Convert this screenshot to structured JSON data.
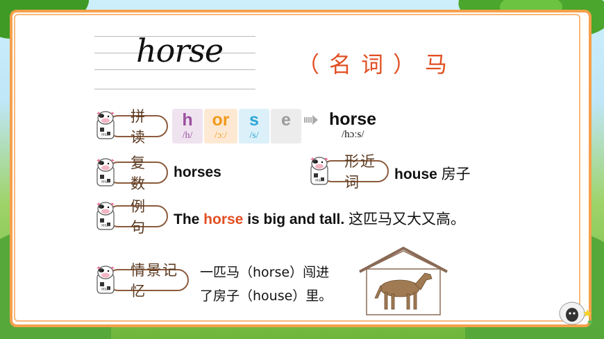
{
  "word": {
    "title": "horse",
    "meaning": "（名词）马"
  },
  "phonics": {
    "label": "拼读",
    "segments": [
      {
        "letters": "h",
        "ipa": "/h/",
        "color": "#9b4f9f",
        "bg": "#efe3f0"
      },
      {
        "letters": "or",
        "ipa": "/ɔː/",
        "color": "#f19a1c",
        "bg": "#fde9d3"
      },
      {
        "letters": "s",
        "ipa": "/s/",
        "color": "#2ba6d8",
        "bg": "#dcf0fa"
      },
      {
        "letters": "e",
        "ipa": "",
        "color": "#9a9a9a",
        "bg": "#ececec"
      }
    ],
    "result": "horse",
    "result_ipa": "/hɔːs/"
  },
  "plural": {
    "label": "复数",
    "value": "horses"
  },
  "similar": {
    "label": "形近词",
    "word": "house",
    "meaning": "房子"
  },
  "example": {
    "label": "例句",
    "pre": "The ",
    "highlight": "horse",
    "post": " is big and tall.",
    "translation": " 这匹马又大又高。"
  },
  "memory": {
    "label": "情景记忆",
    "line1": "一匹马（horse）闯进",
    "line2": "了房子（house）里。"
  },
  "colors": {
    "accent": "#e24f22",
    "border": "#f5a04c",
    "pill_border": "#8b5a3c"
  }
}
